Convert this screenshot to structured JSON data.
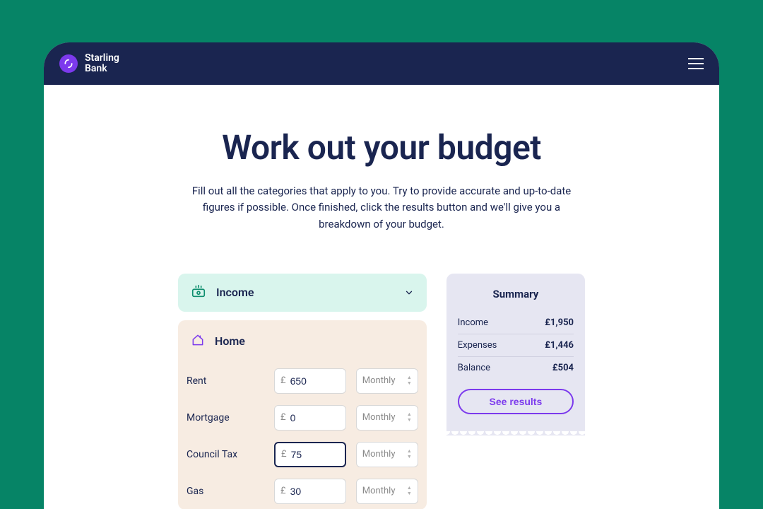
{
  "brand": {
    "line1": "Starling",
    "line2": "Bank"
  },
  "page": {
    "title": "Work out your budget",
    "subtitle": "Fill out all the categories that apply to you. Try to provide accurate and up-to-date figures if possible. Once finished, click the results button and we'll give you a breakdown of your budget."
  },
  "income_section": {
    "label": "Income"
  },
  "home_section": {
    "label": "Home",
    "currency": "£",
    "rows": [
      {
        "label": "Rent",
        "value": "650",
        "freq": "Monthly",
        "focused": false
      },
      {
        "label": "Mortgage",
        "value": "0",
        "freq": "Monthly",
        "focused": false
      },
      {
        "label": "Council Tax",
        "value": "75",
        "freq": "Monthly",
        "focused": true
      },
      {
        "label": "Gas",
        "value": "30",
        "freq": "Monthly",
        "focused": false
      }
    ]
  },
  "summary": {
    "title": "Summary",
    "income_label": "Income",
    "income_value": "£1,950",
    "expenses_label": "Expenses",
    "expenses_value": "£1,446",
    "balance_label": "Balance",
    "balance_value": "£504",
    "results_button": "See results"
  }
}
